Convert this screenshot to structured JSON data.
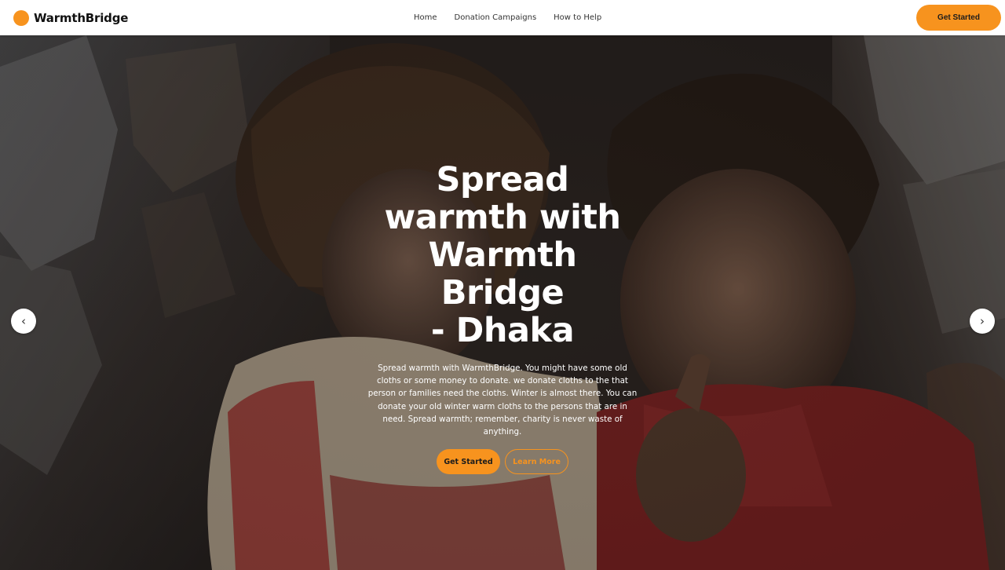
{
  "brand": {
    "name": "WarmthBridge",
    "accent": "#f7931e"
  },
  "nav": {
    "links": [
      "Home",
      "Donation Campaigns",
      "How to Help"
    ],
    "cta_label": "Get Started"
  },
  "hero": {
    "title_lines": [
      "Spread",
      "warmth with",
      "Warmth",
      "Bridge",
      "- Dhaka"
    ],
    "description": "Spread warmth with WarmthBridge. You might have some old cloths or some money to donate. we donate cloths to the that person or families need the cloths. Winter is almost there. You can donate your old winter warm cloths to the persons that are in need. Spread warmth; remember, charity is never waste of anything.",
    "primary_button": "Get Started",
    "secondary_button": "Learn More",
    "prev_arrow": "‹",
    "next_arrow": "›",
    "background_image": "photo of two children in front of a pile of debris"
  }
}
